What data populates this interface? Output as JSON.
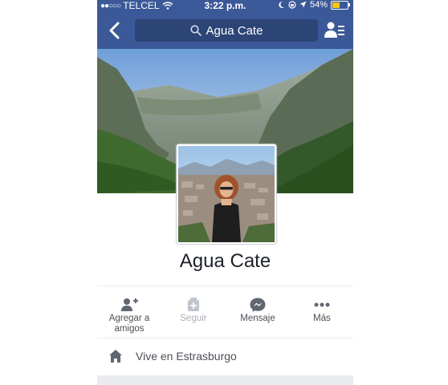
{
  "status_bar": {
    "carrier": "TELCEL",
    "signal_dots": "●●○○○",
    "time": "3:22 p.m.",
    "battery": "54%",
    "battery_level": 0.54
  },
  "nav": {
    "search_text": "Agua Cate"
  },
  "profile": {
    "name": "Agua Cate"
  },
  "actions": [
    {
      "label": "Agregar a\namigos",
      "icon": "add-friend-icon",
      "enabled": true
    },
    {
      "label": "Seguir",
      "icon": "follow-icon",
      "enabled": false
    },
    {
      "label": "Mensaje",
      "icon": "messenger-icon",
      "enabled": true
    },
    {
      "label": "Más",
      "icon": "more-icon",
      "enabled": true
    }
  ],
  "info": {
    "lives_in": "Vive en Estrasburgo"
  },
  "colors": {
    "brand": "#3b5998",
    "search_bg": "#2c4576",
    "action_icon": "#616770",
    "disabled": "#aab0b8"
  }
}
